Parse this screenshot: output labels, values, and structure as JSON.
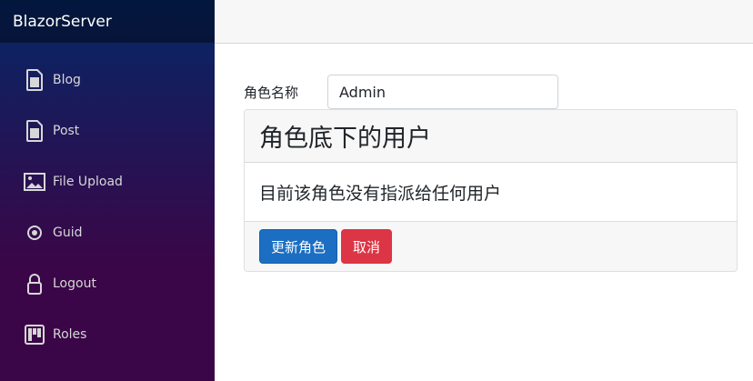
{
  "sidebar": {
    "brand": "BlazorServer",
    "items": [
      {
        "label": "Blog",
        "icon": "document-icon"
      },
      {
        "label": "Post",
        "icon": "document-icon"
      },
      {
        "label": "File Upload",
        "icon": "image-icon"
      },
      {
        "label": "Guid",
        "icon": "target-icon"
      },
      {
        "label": "Logout",
        "icon": "lock-icon"
      },
      {
        "label": "Roles",
        "icon": "board-icon"
      }
    ]
  },
  "form": {
    "role_name_label": "角色名称",
    "role_name_value": "Admin"
  },
  "card": {
    "header": "角色底下的用户",
    "body": "目前该角色没有指派给任何用户",
    "update_button": "更新角色",
    "cancel_button": "取消"
  },
  "colors": {
    "primary": "#1b6ec2",
    "danger": "#dc3545",
    "sidebar_top": "#052767",
    "sidebar_bottom": "#3a0647"
  }
}
